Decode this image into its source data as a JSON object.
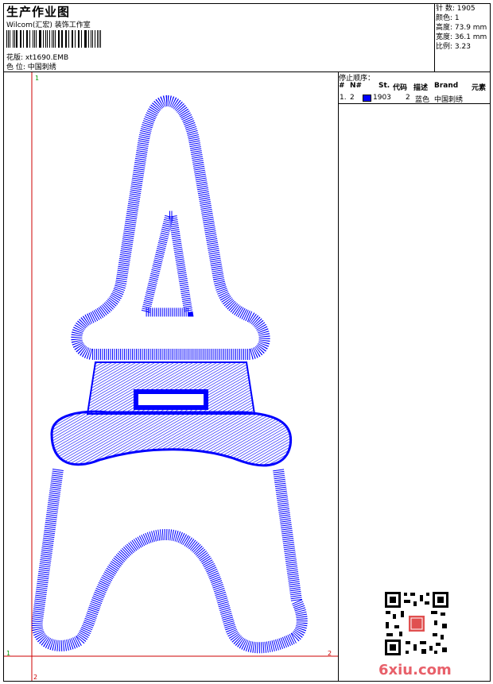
{
  "header": {
    "title": "生产作业图",
    "company": "Wilcom(汇宏) 装饰工作室",
    "design_label": "花版: xt1690.EMB",
    "color_label": "色 位: 中国刺绣"
  },
  "stats": {
    "stitches": "针 数: 1905",
    "colors": "颜色: 1",
    "height": "高度: 73.9 mm",
    "width": "宽度: 36.1 mm",
    "scale": "比例: 3.23"
  },
  "canvas": {
    "marker_top_left": "1",
    "marker_left": "1",
    "marker_right": "2",
    "marker_bottom": "2",
    "stitch_color": "#0000ff",
    "guide_color": "#cc0000"
  },
  "stop_panel": {
    "title": "停止顺序：",
    "columns": [
      "#",
      "N#",
      "St.",
      "代码",
      "描述",
      "Brand",
      "元素"
    ],
    "rows": [
      {
        "index": "1.",
        "needle": "2",
        "swatch": "#0000ff",
        "stitches": "1903",
        "code": "2",
        "desc": "蓝色",
        "brand": "中国刺绣"
      }
    ]
  },
  "watermark": "6xiu.com",
  "icons": {
    "qr": "qr-code-icon",
    "seal": "red-seal-icon"
  }
}
